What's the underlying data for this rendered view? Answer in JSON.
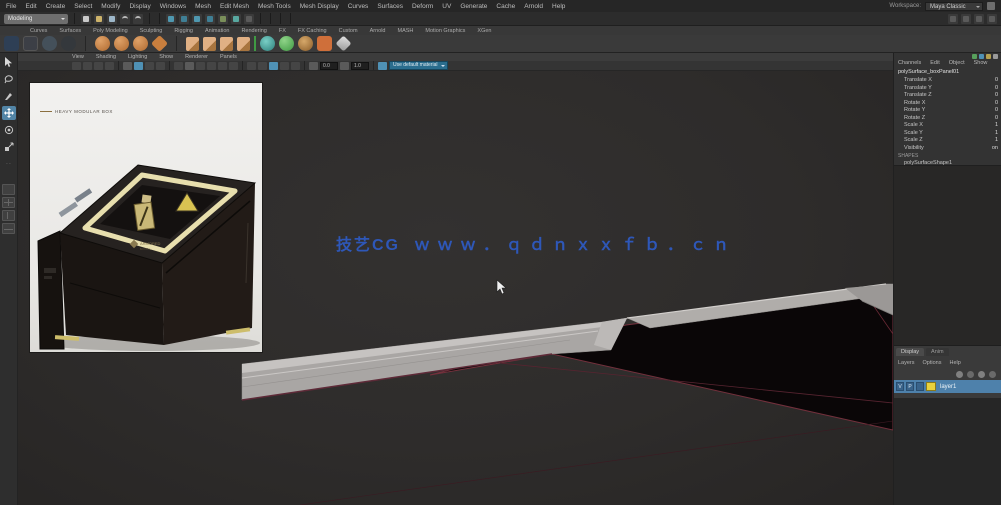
{
  "menubar": {
    "items": [
      "File",
      "Edit",
      "Create",
      "Select",
      "Modify",
      "Display",
      "Windows",
      "Mesh",
      "Edit Mesh",
      "Mesh Tools",
      "Mesh Display",
      "Curves",
      "Surfaces",
      "Deform",
      "UV",
      "Generate",
      "Cache",
      "Arnold",
      "Help"
    ],
    "workspace_label": "Workspace:",
    "workspace_value": "Maya Classic"
  },
  "status_line": {
    "menu_set": "Modeling",
    "icons": [
      "new-scene-icon",
      "open-scene-icon",
      "save-scene-icon",
      "undo-icon",
      "redo-icon",
      "snap-to-grid-icon",
      "snap-to-curve-icon",
      "snap-to-point-icon",
      "snap-to-plane-icon",
      "make-live-icon",
      "render-icon",
      "ipr-render-icon",
      "render-settings-icon"
    ]
  },
  "shelf": {
    "tabs": [
      "Curves",
      "Surfaces",
      "Poly Modeling",
      "Sculpting",
      "Rigging",
      "Animation",
      "Rendering",
      "FX",
      "FX Caching",
      "Custom",
      "Arnold",
      "MASH",
      "Motion Graphics",
      "XGen"
    ],
    "icons": [
      "curve-tool-icon",
      "ep-curve-icon",
      "pencil-curve-icon",
      "three-point-arc-icon",
      "poly-sphere-icon",
      "poly-cube-icon",
      "poly-cylinder-icon",
      "poly-plane-icon",
      "poly-disc-icon",
      "plane-x-icon",
      "plane-y-icon",
      "plane-z-icon",
      "plane-free-icon",
      "platonic-icon",
      "nurbs-sphere-icon",
      "smooth-mesh-icon",
      "bevel-icon",
      "extrude-icon",
      "multi-cut-icon"
    ]
  },
  "panel_menus": [
    "View",
    "Shading",
    "Lighting",
    "Show",
    "Renderer",
    "Panels"
  ],
  "viewport_toolbar": {
    "exposure": "0.0",
    "gamma": "1.0",
    "dropdown_value": "Use default material"
  },
  "viewport": {
    "watermark_brand": "技艺CG",
    "watermark_url": "ｗｗｗ．ｑｄｎｘｘｆｂ．ｃｎ",
    "reference_caption": "HEAVY MODULAR BOX",
    "model_surface_color": "#a9a6a4",
    "wireframe_edge_color": "#73303c",
    "watermark_color": "#2e57b8"
  },
  "channel_box": {
    "menus": [
      "Channels",
      "Edit",
      "Object",
      "Show"
    ],
    "object_name": "polySurface_boxPanel01",
    "channels": [
      {
        "name": "Translate X",
        "value": "0"
      },
      {
        "name": "Translate Y",
        "value": "0"
      },
      {
        "name": "Translate Z",
        "value": "0"
      },
      {
        "name": "Rotate X",
        "value": "0"
      },
      {
        "name": "Rotate Y",
        "value": "0"
      },
      {
        "name": "Rotate Z",
        "value": "0"
      },
      {
        "name": "Scale X",
        "value": "1"
      },
      {
        "name": "Scale Y",
        "value": "1"
      },
      {
        "name": "Scale Z",
        "value": "1"
      },
      {
        "name": "Visibility",
        "value": "on"
      }
    ],
    "shapes_label": "SHAPES",
    "shape_name": "polySurfaceShape1"
  },
  "layer_editor": {
    "tabs": [
      "Display",
      "Anim"
    ],
    "menus": [
      "Layers",
      "Options",
      "Help"
    ],
    "layer": {
      "toggles": [
        "V",
        "P",
        ""
      ],
      "color": "#e8d23e",
      "name": "layer1",
      "selected": true
    }
  }
}
